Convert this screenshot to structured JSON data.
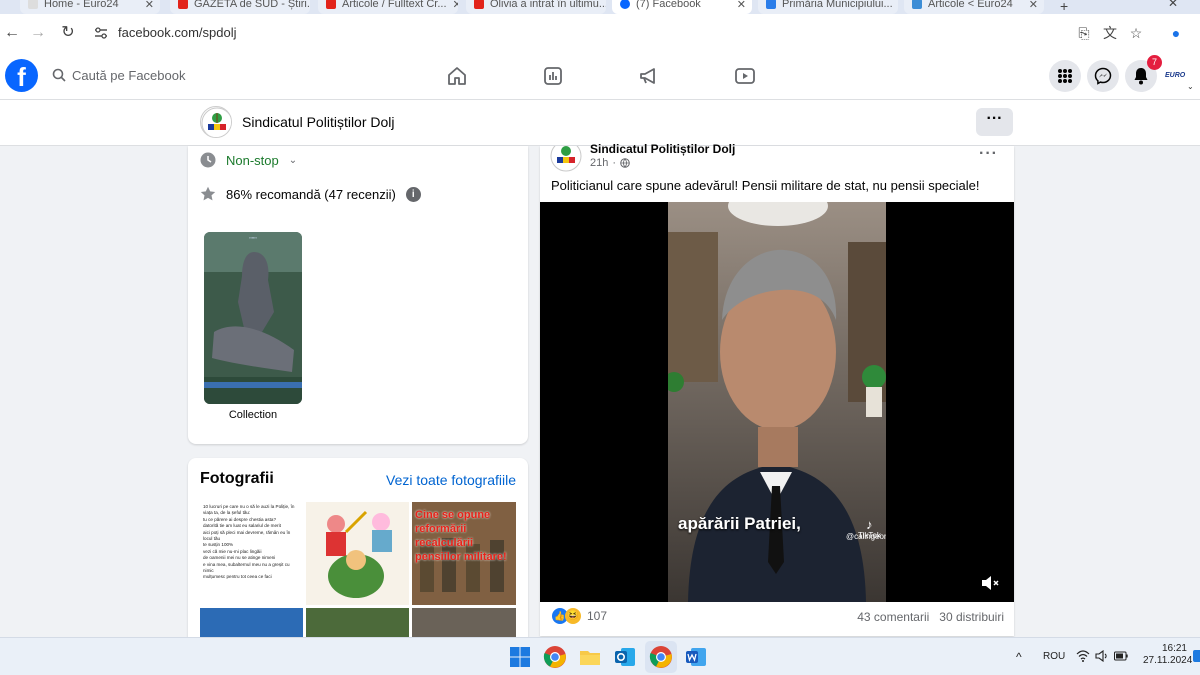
{
  "browser": {
    "tabs": [
      {
        "label": "Home - Euro24",
        "color": "#ffffff"
      },
      {
        "label": "GAZETA de SUD - Știri...",
        "color": "#e2231a"
      },
      {
        "label": "Articole / Fulltext Cr...",
        "color": "#e2231a"
      },
      {
        "label": "Olivia a intrat în ultimu...",
        "color": "#e2231a"
      },
      {
        "label": "(7) Facebook",
        "color": "#0866ff"
      },
      {
        "label": "Primăria Municipiului...",
        "color": "#2b7de9"
      },
      {
        "label": "Articole < Euro24",
        "color": "#3c8dd6"
      }
    ],
    "url": "facebook.com/spdolj"
  },
  "facebook": {
    "logo_letter": "f",
    "search_placeholder": "Caută pe Facebook",
    "notification_count": "7",
    "euro_label": "EURO"
  },
  "page": {
    "name": "Sindicatul Politiștilor Dolj",
    "hours": "Non-stop",
    "rating": "86% recomandă (47 recenzii)",
    "collection_label": "Collection",
    "photos_title": "Fotografii",
    "photos_link": "Vezi toate fotografiile",
    "photo1_text": [
      "10 lucruri pe care nu o să le auzi la Poliție, în viața ta, de la șeful tău:",
      "tu ce părere ai despre chestia asta?",
      "datorită tie am luat eu salariul de merit",
      "aici poți să pleci mai devreme, rămân eu în locul tău",
      "te susțin 100%",
      "vezi că mie nu-mi plac lingăii",
      "de oamenii mei nu se atinge nimeni",
      "e vina mea, subalternul meu nu a greșit cu nimic",
      "mulțumesc pentru tot ceea ce faci"
    ],
    "photo3_text": "Cine se opune reformării recalculării pensiilor militare!"
  },
  "post": {
    "author": "Sindicatul Politiștilor Dolj",
    "time": "21h",
    "text": "Politicianul care spune adevărul! Pensii militare de stat, nu pensii speciale!",
    "caption": "apărării Patriei,",
    "tiktok_label": "TikTok",
    "tiktok_handle": "@calingeorgescuoficial",
    "reaction_count": "107",
    "comments": "43 comentarii",
    "shares": "30 distribuiri"
  },
  "taskbar": {
    "language": "ROU",
    "time": "16:21",
    "date": "27.11.2024"
  }
}
